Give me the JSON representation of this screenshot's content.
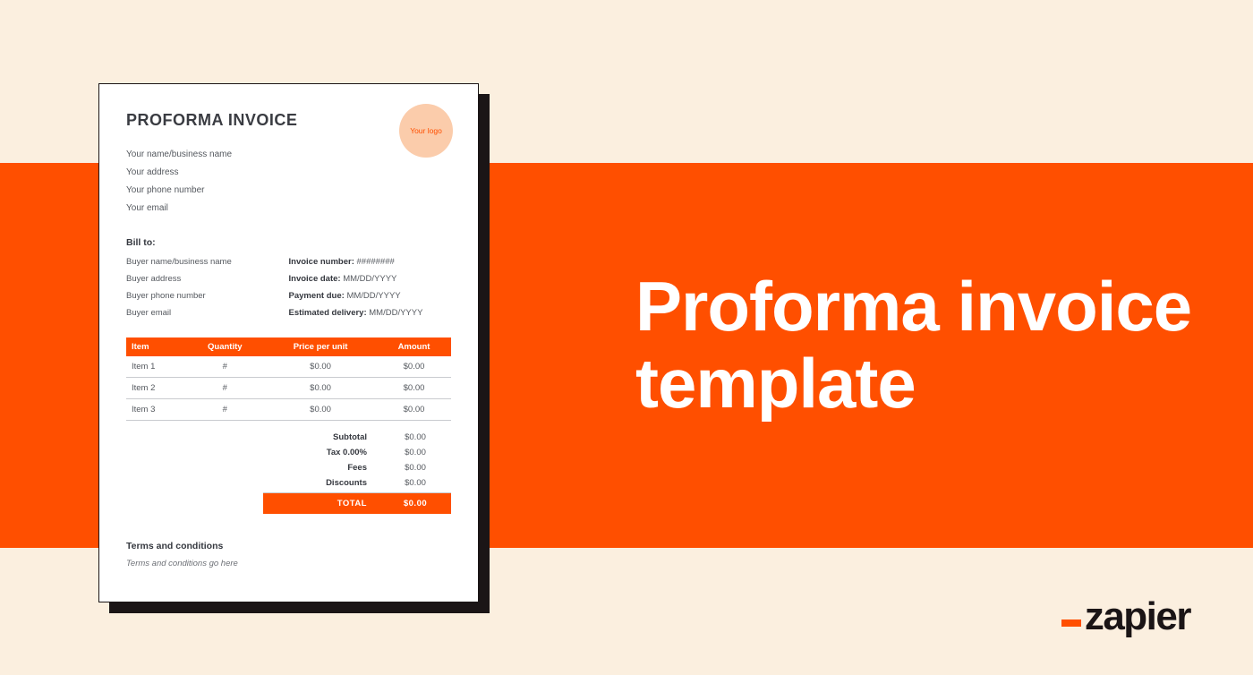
{
  "hero": {
    "title_line1": "Proforma invoice",
    "title_line2": "template"
  },
  "brand": {
    "name": "zapier"
  },
  "invoice": {
    "title": "PROFORMA INVOICE",
    "logo_label": "Your logo",
    "sender": {
      "name": "Your name/business name",
      "address": "Your address",
      "phone": "Your phone number",
      "email": "Your email"
    },
    "bill_to_label": "Bill to:",
    "buyer": {
      "name": "Buyer name/business name",
      "address": "Buyer address",
      "phone": "Buyer phone number",
      "email": "Buyer email"
    },
    "meta": {
      "invoice_number_label": "Invoice number:",
      "invoice_number": "########",
      "invoice_date_label": "Invoice date:",
      "invoice_date": "MM/DD/YYYY",
      "payment_due_label": "Payment due:",
      "payment_due": "MM/DD/YYYY",
      "estimated_delivery_label": "Estimated delivery:",
      "estimated_delivery": "MM/DD/YYYY"
    },
    "table": {
      "headers": {
        "item": "Item",
        "quantity": "Quantity",
        "price": "Price per unit",
        "amount": "Amount"
      },
      "rows": [
        {
          "item": "Item 1",
          "quantity": "#",
          "price": "$0.00",
          "amount": "$0.00"
        },
        {
          "item": "Item 2",
          "quantity": "#",
          "price": "$0.00",
          "amount": "$0.00"
        },
        {
          "item": "Item 3",
          "quantity": "#",
          "price": "$0.00",
          "amount": "$0.00"
        }
      ]
    },
    "totals": {
      "subtotal_label": "Subtotal",
      "subtotal": "$0.00",
      "tax_label": "Tax 0.00%",
      "tax": "$0.00",
      "fees_label": "Fees",
      "fees": "$0.00",
      "discounts_label": "Discounts",
      "discounts": "$0.00",
      "total_label": "TOTAL",
      "total": "$0.00"
    },
    "terms": {
      "heading": "Terms and conditions",
      "body": "Terms and conditions go here"
    }
  }
}
